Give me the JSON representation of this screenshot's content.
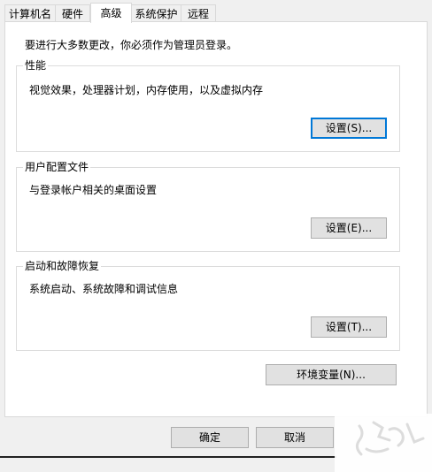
{
  "tabs": [
    {
      "label": "计算机名"
    },
    {
      "label": "硬件"
    },
    {
      "label": "高级"
    },
    {
      "label": "系统保护"
    },
    {
      "label": "远程"
    }
  ],
  "active_tab": "高级",
  "intro_text": "要进行大多数更改，你必须作为管理员登录。",
  "groups": {
    "performance": {
      "title": "性能",
      "description": "视觉效果，处理器计划，内存使用，以及虚拟内存",
      "button_label": "设置(S)..."
    },
    "user_profiles": {
      "title": "用户配置文件",
      "description": "与登录帐户相关的桌面设置",
      "button_label": "设置(E)..."
    },
    "startup_recovery": {
      "title": "启动和故障恢复",
      "description": "系统启动、系统故障和调试信息",
      "button_label": "设置(T)..."
    }
  },
  "env_button_label": "环境变量(N)...",
  "footer": {
    "ok_label": "确定",
    "cancel_label": "取消"
  },
  "colors": {
    "window_bg": "#f0f0f0",
    "panel_bg": "#ffffff",
    "button_bg": "#e1e1e1",
    "focus_accent": "#0078d7"
  }
}
